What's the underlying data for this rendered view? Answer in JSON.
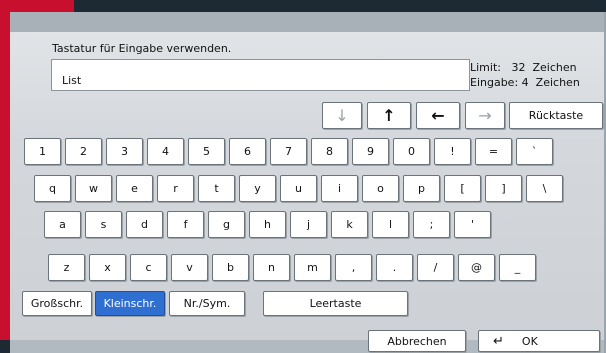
{
  "keyboard_prompt": "Tastatur für Eingabe verwenden.",
  "input_value": "List",
  "limit_label": "Limit:",
  "limit_value": "32",
  "limit_unit": "Zeichen",
  "entry_label": "Eingabe:",
  "entry_value": "4",
  "entry_unit": "Zeichen",
  "nav": {
    "down": "↓",
    "up": "↑",
    "left": "←",
    "right": "→",
    "backspace": "Rücktaste"
  },
  "rows": [
    [
      "1",
      "2",
      "3",
      "4",
      "5",
      "6",
      "7",
      "8",
      "9",
      "0",
      "!",
      "=",
      "`"
    ],
    [
      "q",
      "w",
      "e",
      "r",
      "t",
      "y",
      "u",
      "i",
      "o",
      "p",
      "[",
      "]",
      "\\"
    ],
    [
      "a",
      "s",
      "d",
      "f",
      "g",
      "h",
      "j",
      "k",
      "l",
      ";",
      "'"
    ],
    [
      "z",
      "x",
      "c",
      "v",
      "b",
      "n",
      "m",
      ",",
      ".",
      "/",
      "@",
      "_"
    ]
  ],
  "modes": {
    "upper": "Großschr.",
    "lower": "Kleinschr.",
    "numsym": "Nr./Sym.",
    "space": "Leertaste",
    "selected": "lower"
  },
  "actions": {
    "cancel": "Abbrechen",
    "ok": "OK",
    "ok_icon": "↵"
  },
  "colors": {
    "accent": "#c8102e",
    "selected_key": "#2f6fd1"
  }
}
